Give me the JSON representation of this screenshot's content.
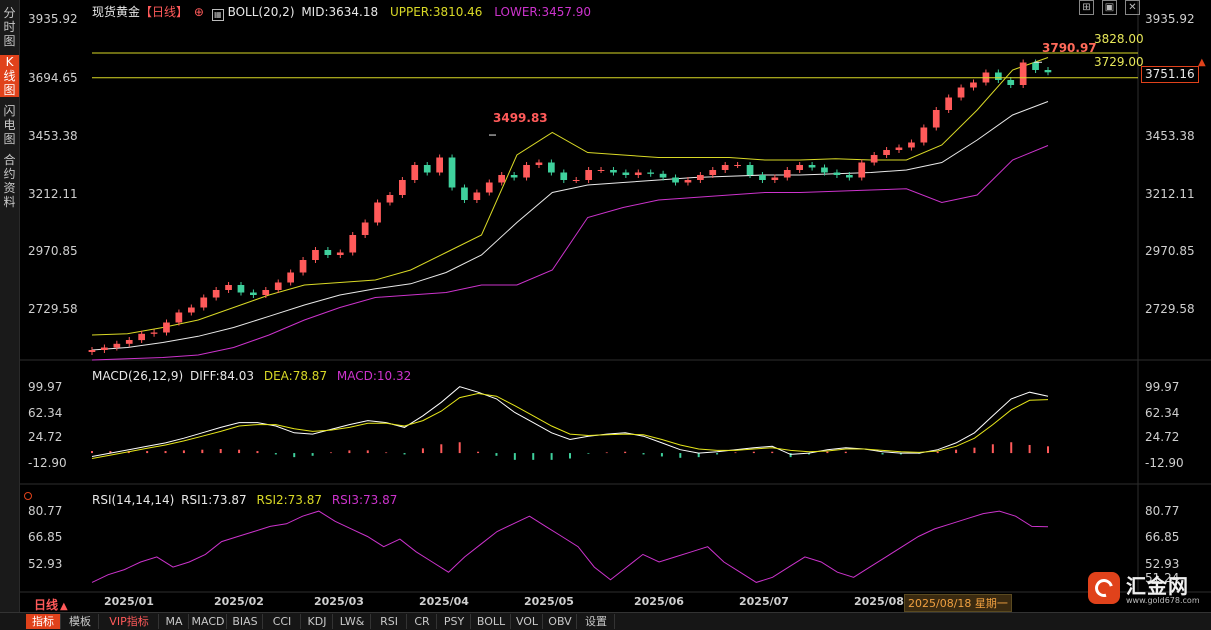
{
  "sidebar": {
    "tabs": [
      {
        "label": "分时图",
        "active": false
      },
      {
        "label": "K线图",
        "active": true
      },
      {
        "label": "闪电图",
        "active": false
      },
      {
        "label": "合约资料",
        "active": false
      }
    ]
  },
  "header": {
    "instrument": "现货黄金",
    "period": "【日线】",
    "boll_label": "BOLL(20,2)",
    "mid": "MID:3634.18",
    "upper": "UPPER:3810.46",
    "lower": "LOWER:3457.90"
  },
  "macd_header": {
    "label": "MACD(26,12,9)",
    "diff": "DIFF:84.03",
    "dea": "DEA:78.87",
    "macd": "MACD:10.32"
  },
  "rsi_header": {
    "label": "RSI(14,14,14)",
    "rsi1": "RSI1:73.87",
    "rsi2": "RSI2:73.87",
    "rsi3": "RSI3:73.87"
  },
  "price_axis": [
    "3935.92",
    "3694.65",
    "3453.38",
    "3212.11",
    "2970.85",
    "2729.58"
  ],
  "macd_axis": [
    "99.97",
    "62.34",
    "24.72",
    "-12.90"
  ],
  "rsi_axis": [
    "80.77",
    "66.85",
    "52.93"
  ],
  "rsi_axis_partial": "51.24",
  "annotations": {
    "line_3828": "3828.00",
    "line_3729": "3729.00",
    "peak_high": "3790.97",
    "apr_high": "3499.83",
    "last_price": "3751.16"
  },
  "months": [
    "2025/01",
    "2025/02",
    "2025/03",
    "2025/04",
    "2025/05",
    "2025/06",
    "2025/07",
    "2025/08"
  ],
  "cursor_date": "2025/08/18 星期一",
  "period_selector": "日线",
  "bottom_tabs": [
    {
      "label": "指标",
      "active": true
    },
    {
      "label": "模板",
      "active": false
    },
    {
      "label": "VIP指标",
      "active": false,
      "vip": true
    },
    {
      "label": "MA",
      "active": false
    },
    {
      "label": "MACD",
      "active": false
    },
    {
      "label": "BIAS",
      "active": false
    },
    {
      "label": "CCI",
      "active": false
    },
    {
      "label": "KDJ",
      "active": false
    },
    {
      "label": "LW&",
      "active": false
    },
    {
      "label": "RSI",
      "active": false
    },
    {
      "label": "CR",
      "active": false
    },
    {
      "label": "PSY",
      "active": false
    },
    {
      "label": "BOLL",
      "active": false
    },
    {
      "label": "VOL",
      "active": false
    },
    {
      "label": "OBV",
      "active": false
    },
    {
      "label": "设置",
      "active": false
    }
  ],
  "logo": {
    "name": "汇金网",
    "url": "www.gold678.com"
  },
  "colors": {
    "up": "#ff5a5a",
    "down": "#3fd19d",
    "boll_mid": "#e8e8e8",
    "boll_upper": "#d9d926",
    "boll_lower": "#cc33cc",
    "diff": "#ffffff",
    "dea": "#e6e61a",
    "rsi": "#cc33cc",
    "hline": "#d9d926",
    "accent": "#e0421b"
  },
  "chart_data": [
    {
      "type": "candlestick",
      "title": "现货黄金 【日线】",
      "ylim": [
        2620,
        3960
      ],
      "horizontal_lines": [
        3828.0,
        3729.0
      ],
      "series": [
        {
          "name": "MID",
          "values": [
            2640,
            2650,
            2670,
            2695,
            2730,
            2775,
            2820,
            2860,
            2885,
            2905,
            2950,
            3020,
            3150,
            3270,
            3300,
            3310,
            3320,
            3330,
            3335,
            3340,
            3340,
            3345,
            3350,
            3360,
            3390,
            3480,
            3580,
            3634
          ]
        },
        {
          "name": "UPPER",
          "values": [
            2700,
            2705,
            2730,
            2760,
            2810,
            2860,
            2900,
            2910,
            2920,
            2960,
            3030,
            3100,
            3420,
            3510,
            3430,
            3420,
            3410,
            3410,
            3410,
            3400,
            3400,
            3405,
            3400,
            3400,
            3460,
            3600,
            3760,
            3810
          ]
        },
        {
          "name": "LOWER",
          "values": [
            2600,
            2605,
            2610,
            2620,
            2650,
            2700,
            2760,
            2810,
            2850,
            2860,
            2870,
            2900,
            2900,
            2960,
            3170,
            3210,
            3240,
            3250,
            3260,
            3270,
            3270,
            3275,
            3280,
            3285,
            3230,
            3260,
            3400,
            3458
          ]
        }
      ],
      "closes": [
        2640,
        2650,
        2665,
        2680,
        2705,
        2710,
        2750,
        2790,
        2810,
        2850,
        2880,
        2900,
        2870,
        2860,
        2880,
        2910,
        2950,
        3000,
        3040,
        3020,
        3030,
        3100,
        3150,
        3230,
        3260,
        3320,
        3380,
        3350,
        3410,
        3290,
        3240,
        3270,
        3310,
        3340,
        3330,
        3380,
        3390,
        3350,
        3320,
        3320,
        3360,
        3360,
        3350,
        3340,
        3350,
        3345,
        3330,
        3310,
        3320,
        3340,
        3360,
        3380,
        3380,
        3340,
        3320,
        3330,
        3360,
        3380,
        3370,
        3350,
        3340,
        3330,
        3390,
        3420,
        3440,
        3450,
        3470,
        3530,
        3600,
        3650,
        3690,
        3710,
        3750,
        3720,
        3700,
        3790,
        3760,
        3751
      ],
      "annotations": [
        {
          "x": "2025/04",
          "y": 3499.83,
          "text": "3499.83"
        },
        {
          "x": "2025/09",
          "y": 3790.97,
          "text": "3790.97"
        }
      ]
    },
    {
      "type": "line",
      "title": "MACD(26,12,9)",
      "ylim": [
        -25,
        105
      ],
      "series": [
        {
          "name": "DIFF",
          "values": [
            -5,
            0,
            5,
            10,
            15,
            22,
            30,
            38,
            45,
            45,
            40,
            30,
            28,
            35,
            42,
            48,
            45,
            38,
            55,
            75,
            98,
            90,
            80,
            60,
            45,
            30,
            20,
            25,
            28,
            30,
            25,
            15,
            5,
            0,
            2,
            5,
            8,
            10,
            -2,
            0,
            5,
            8,
            6,
            2,
            0,
            0,
            5,
            15,
            30,
            55,
            80,
            90,
            84
          ]
        },
        {
          "name": "DEA",
          "values": [
            -8,
            -3,
            2,
            7,
            12,
            18,
            25,
            32,
            40,
            42,
            42,
            36,
            32,
            34,
            38,
            44,
            44,
            40,
            48,
            62,
            82,
            88,
            84,
            70,
            55,
            40,
            28,
            26,
            27,
            28,
            27,
            20,
            12,
            6,
            4,
            4,
            6,
            8,
            4,
            2,
            3,
            6,
            6,
            4,
            2,
            1,
            3,
            10,
            22,
            42,
            64,
            78,
            79
          ]
        },
        {
          "name": "MACD",
          "values": [
            3,
            3,
            3,
            3,
            3,
            4,
            5,
            6,
            5,
            3,
            -2,
            -6,
            -4,
            1,
            4,
            4,
            1,
            -2,
            7,
            13,
            16,
            2,
            -4,
            -10,
            -10,
            -10,
            -8,
            -1,
            1,
            2,
            -2,
            -5,
            -7,
            -6,
            -2,
            1,
            2,
            2,
            -6,
            -2,
            2,
            2,
            0,
            -2,
            -2,
            -1,
            2,
            5,
            8,
            13,
            16,
            12,
            10
          ]
        }
      ],
      "last": {
        "DIFF": 84.03,
        "DEA": 78.87,
        "MACD": 10.32
      }
    },
    {
      "type": "line",
      "title": "RSI(14,14,14)",
      "ylim": [
        49,
        82
      ],
      "series": [
        {
          "name": "RSI1",
          "values": [
            52,
            55,
            57,
            60,
            62,
            58,
            60,
            63,
            68,
            70,
            72,
            74,
            75,
            78,
            80,
            76,
            73,
            70,
            66,
            69,
            64,
            60,
            56,
            62,
            67,
            72,
            75,
            78,
            74,
            70,
            66,
            58,
            53,
            58,
            63,
            60,
            62,
            64,
            66,
            60,
            56,
            52,
            54,
            58,
            62,
            60,
            56,
            54,
            58,
            62,
            66,
            70,
            73,
            75,
            77,
            79,
            80,
            78,
            74,
            73.87
          ]
        }
      ],
      "last": {
        "RSI1": 73.87,
        "RSI2": 73.87,
        "RSI3": 73.87
      }
    }
  ]
}
